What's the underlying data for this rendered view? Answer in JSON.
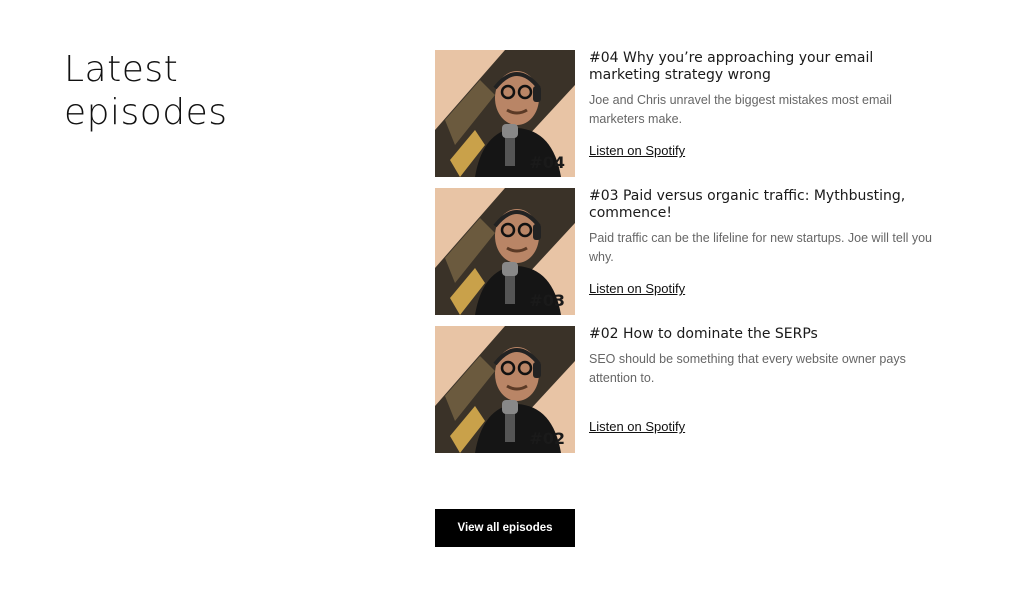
{
  "section": {
    "title_line1": "Latest",
    "title_line2": "episodes"
  },
  "episodes": [
    {
      "badge": "#04",
      "title": "#04 Why you’re approaching your email marketing strategy wrong",
      "description": "Joe and Chris unravel the biggest mistakes most email marketers make.",
      "link": "Listen on Spotify"
    },
    {
      "badge": "#03",
      "title": "#03 Paid versus organic traffic: Mythbusting, commence!",
      "description": "Paid traffic can be the lifeline for new startups. Joe will tell you why.",
      "link": "Listen on Spotify"
    },
    {
      "badge": "#02",
      "title": "#02 How to dominate the SERPs",
      "description": "SEO should be something that every website owner pays attention to.",
      "link": "Listen on Spotify"
    }
  ],
  "cta": {
    "label": "View all episodes"
  },
  "colors": {
    "thumb_bg": "#e8c4a5",
    "button_bg": "#000000",
    "text": "#111111",
    "muted": "#666666"
  }
}
